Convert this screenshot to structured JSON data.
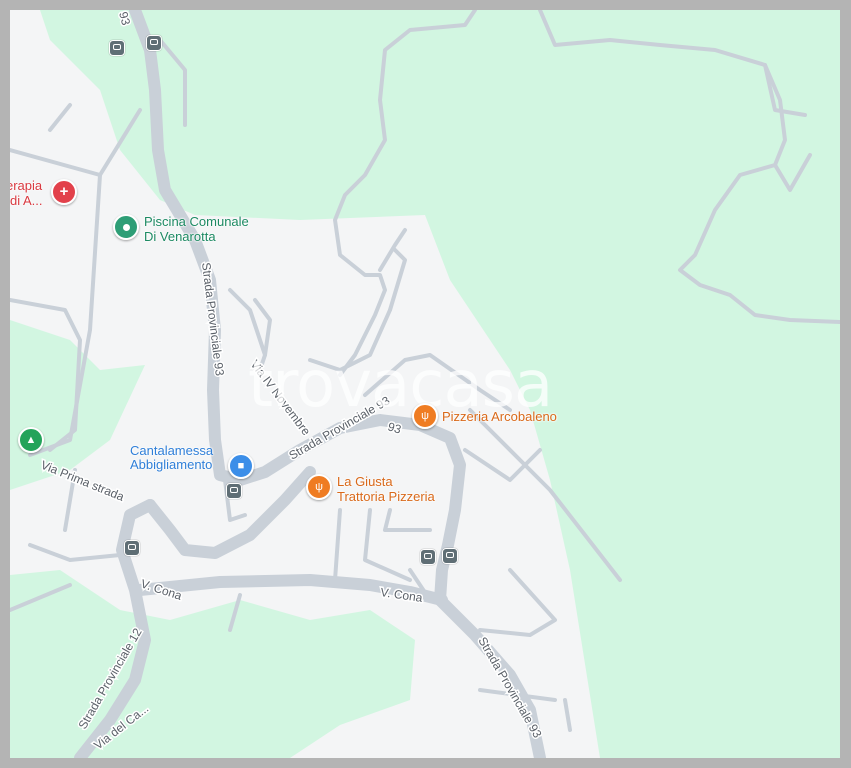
{
  "map": {
    "watermark": "trovacasa",
    "colors": {
      "park": "#d2f6e1",
      "land": "#f4f5f6",
      "road": "#c9d0d8",
      "frame": "#b4b4b4",
      "poi_restaurant": "#ef7c22",
      "poi_shop": "#3c8ee8",
      "poi_health": "#e2414b",
      "poi_leisure": "#2e9e76",
      "poi_park": "#24a35a",
      "bus_stop": "#5f6e75"
    },
    "roads": {
      "sp93_top": "93",
      "sp93_vertical": "Strada Provinciale 93",
      "sp93_middle": "Strada Provinciale 93",
      "sp93_bottom": "Strada Provinciale 93",
      "via_iv_novembre": "Via IV Novembre",
      "via_prima_strada": "Via Prima strada",
      "v_cona_left": "V. Cona",
      "v_cona_right": "V. Cona",
      "sp12": "Strada Provinciale 12",
      "via_del_ca": "Via del Ca..."
    },
    "pois": {
      "terapia_line1": "erapia",
      "terapia_line2": "di A...",
      "piscina_line1": "Piscina Comunale",
      "piscina_line2": "Di Venarotta",
      "pizzeria_arcobaleno": "Pizzeria Arcobaleno",
      "cantalamessa_line1": "Cantalamessa",
      "cantalamessa_line2": "Abbigliamento",
      "giusta_line1": "La Giusta",
      "giusta_line2": "Trattoria Pizzeria"
    },
    "icons": {
      "health": "first-aid-icon",
      "pool": "pool-icon",
      "restaurant": "fork-knife-icon",
      "shop": "shopping-bag-icon",
      "park": "tree-icon",
      "bus": "bus-stop-icon"
    }
  }
}
